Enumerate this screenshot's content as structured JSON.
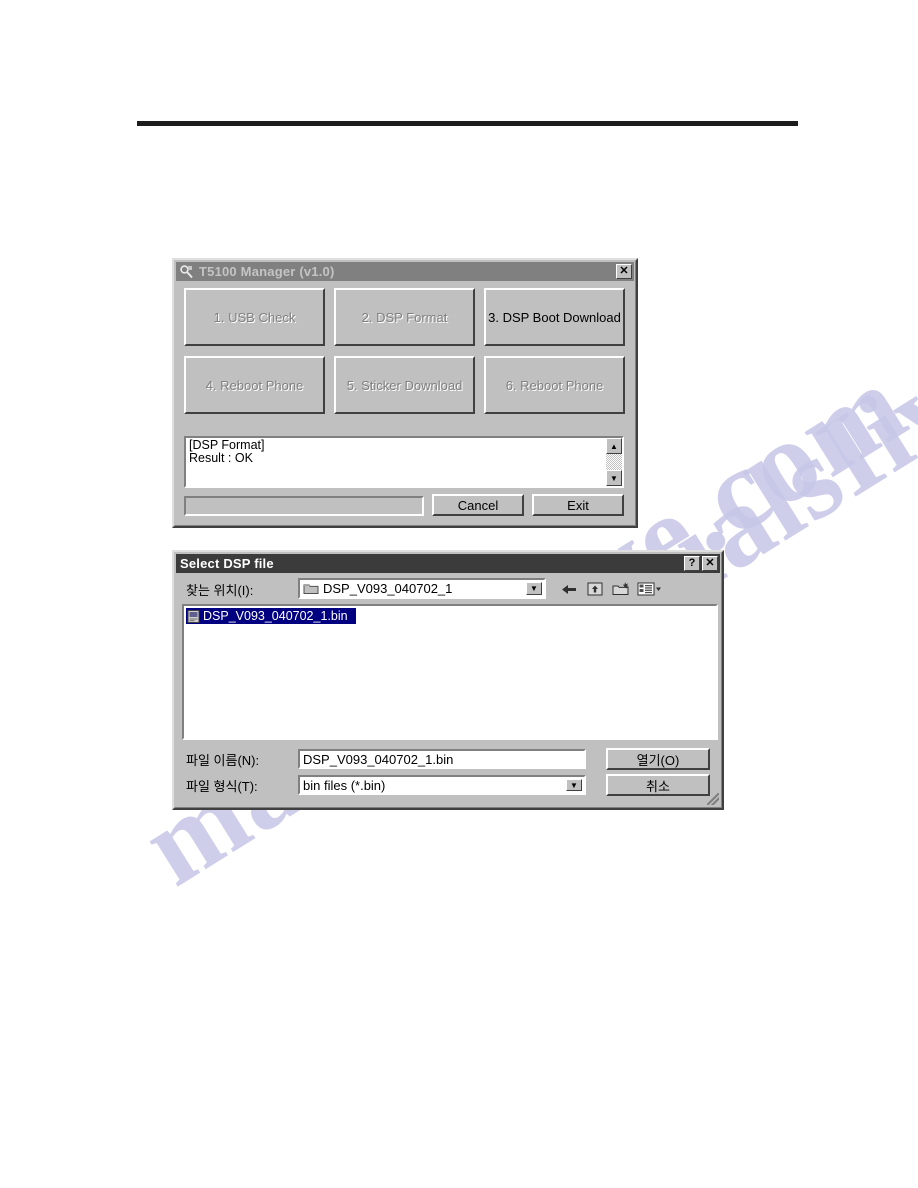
{
  "page": {
    "watermark_line1": "manualsIive.com",
    "watermark_line2": "manualsIive.com"
  },
  "manager_window": {
    "title": "T5100 Manager (v1.0)",
    "title_icon": "wrench-magnifier-icon",
    "close_label": "✕",
    "buttons": [
      {
        "label": "1. USB Check",
        "enabled": false
      },
      {
        "label": "2. DSP Format",
        "enabled": false
      },
      {
        "label": "3. DSP Boot Download",
        "enabled": true
      },
      {
        "label": "4. Reboot Phone",
        "enabled": false
      },
      {
        "label": "5. Sticker Download",
        "enabled": false
      },
      {
        "label": "6. Reboot Phone",
        "enabled": false
      }
    ],
    "log": "[DSP Format]\nResult : OK",
    "progress_value": "",
    "scroll_up": "▲",
    "scroll_down": "▼",
    "cancel_label": "Cancel",
    "exit_label": "Exit"
  },
  "file_dialog": {
    "title": "Select DSP file",
    "help_label": "?",
    "close_label": "✕",
    "look_in_label": "찾는 위치(I):",
    "look_in_value": "DSP_V093_040702_1",
    "combo_arrow": "▼",
    "toolbar_icons": [
      "back-arrow-icon",
      "up-one-level-icon",
      "new-folder-icon",
      "views-menu-icon"
    ],
    "files": [
      {
        "name": "DSP_V093_040702_1.bin",
        "icon": "bin-file-icon",
        "selected": true
      }
    ],
    "file_name_label": "파일 이름(N):",
    "file_name_value": "DSP_V093_040702_1.bin",
    "file_type_label": "파일 형식(T):",
    "file_type_value": "bin files (*.bin)",
    "open_label": "열기(O)",
    "cancel_label": "취소"
  },
  "colors": {
    "face": "#c0c0c0",
    "title_inactive": "#808080",
    "title_active": "#3b3b3b",
    "selection": "#000080",
    "watermark": "#c6c6e8"
  }
}
